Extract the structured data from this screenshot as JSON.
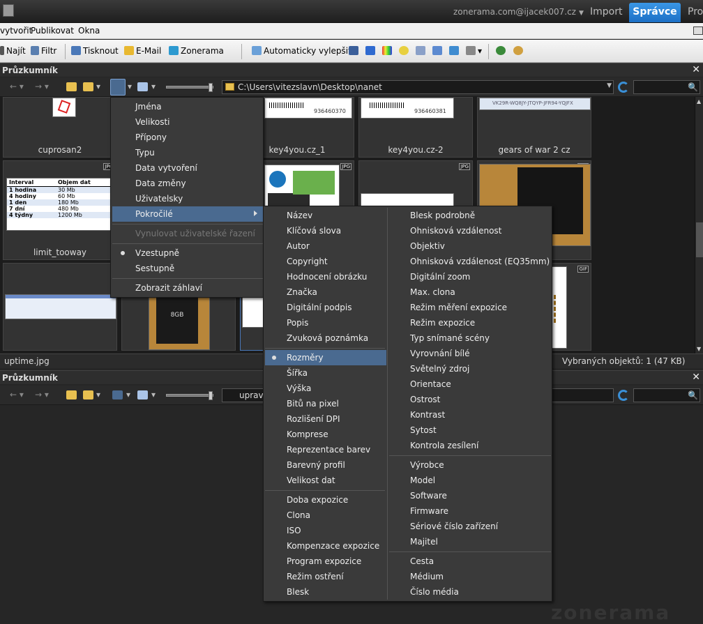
{
  "account": "zonerama.com@ijacek007.cz",
  "tabs": {
    "import": "Import",
    "spravce": "Správce",
    "pro": "Pro"
  },
  "menubar": [
    "vytvořit",
    "Publikovat",
    "Okna"
  ],
  "toolbar": {
    "najit": "Najít",
    "filtr": "Filtr",
    "tisknout": "Tisknout",
    "email": "E-Mail",
    "zonerama": "Zonerama",
    "auto": "Automaticky vylepšit"
  },
  "panel_title": "Průzkumník",
  "path": "C:\\Users\\vitezslavn\\Desktop\\nanet",
  "path2": "upravy",
  "thumbs": {
    "cuprosan": "cuprosan2",
    "key1": "key4you.cz_1",
    "key2": "key4you.cz-2",
    "gears": "gears of war 2 cz",
    "limit": "limit_tooway",
    "barcode1": "936460370",
    "barcode2": "936460381",
    "gears_key": "VK29R-WQ8JY-JTQYP-JFR94-YQJFX",
    "table": {
      "headers": [
        "Interval",
        "Objem dat"
      ],
      "rows": [
        [
          "1 hodina",
          "30 Mb"
        ],
        [
          "4 hodiny",
          "60 Mb"
        ],
        [
          "1 den",
          "180 Mb"
        ],
        [
          "7 dní",
          "480 Mb"
        ],
        [
          "4 týdny",
          "1200 Mb"
        ]
      ]
    },
    "badge_jpg": "JPG",
    "badge_gif": "GIF",
    "sd_text": "8GB"
  },
  "status": {
    "left": "uptime.jpg",
    "right": "Vybraných objektů: 1 (47 KB)"
  },
  "sort_menu": {
    "items": [
      "Jména",
      "Velikosti",
      "Přípony",
      "Typu",
      "Data vytvoření",
      "Data změny",
      "Uživatelsky",
      "Pokročilé"
    ],
    "reset": "Vynulovat uživatelské řazení",
    "asc": "Vzestupně",
    "desc": "Sestupně",
    "header": "Zobrazit záhlaví"
  },
  "adv_col1": {
    "g1": [
      "Název",
      "Klíčová slova",
      "Autor",
      "Copyright",
      "Hodnocení obrázku",
      "Značka",
      "Digitální podpis",
      "Popis",
      "Zvuková poznámka"
    ],
    "g2": [
      "Rozměry",
      "Šířka",
      "Výška",
      "Bitů na pixel",
      "Rozlišení DPI",
      "Komprese",
      "Reprezentace barev",
      "Barevný profil",
      "Velikost dat"
    ],
    "g3": [
      "Doba expozice",
      "Clona",
      "ISO",
      "Kompenzace expozice",
      "Program expozice",
      "Režim ostření",
      "Blesk"
    ]
  },
  "adv_col2": {
    "g1": [
      "Blesk podrobně",
      "Ohnisková vzdálenost",
      "Objektiv",
      "Ohnisková vzdálenost (EQ35mm)",
      "Digitální zoom",
      "Max. clona",
      "Režim měření expozice",
      "Režim expozice",
      "Typ snímané scény",
      "Vyrovnání bílé",
      "Světelný zdroj",
      "Orientace",
      "Ostrost",
      "Kontrast",
      "Sytost",
      "Kontrola zesílení"
    ],
    "g2": [
      "Výrobce",
      "Model",
      "Software",
      "Firmware",
      "Sériové číslo zařízení",
      "Majitel"
    ],
    "g3": [
      "Cesta",
      "Médium",
      "Číslo média"
    ]
  },
  "watermark": "zonerama",
  "colors": {
    "accent": "#2a84d8",
    "selection": "#4a6a90"
  }
}
